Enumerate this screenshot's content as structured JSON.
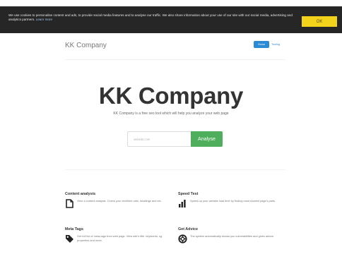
{
  "cookie": {
    "text": "We use cookies to personalise content and ads, to provide social media features and to analyse our traffic. We also share information about your use of our site with our social media, advertising and analytics partners.",
    "link": "Learn more",
    "ok_label": "OK"
  },
  "header": {
    "brand": "KK Company",
    "nav": {
      "home": "Home",
      "tools": "Tooling"
    }
  },
  "hero": {
    "title": "KK Company",
    "subtitle": "KK Company is a free seo tool which will help you analyze your web page",
    "input_placeholder": "website.com",
    "analyse_label": "Analyse"
  },
  "features": [
    {
      "title": "Content analysis",
      "desc": "View a content analysis. Check your text/html ratio, headings and etc.",
      "icon": "file-icon"
    },
    {
      "title": "Speed Test",
      "desc": "Speed-up your website load time by finding most slowest page's parts.",
      "icon": "bar-chart-icon"
    },
    {
      "title": "Meta Tags",
      "desc": "Get full list of meta-tags from web page. View site's title, keywords, og properties and more.",
      "icon": "tag-icon"
    },
    {
      "title": "Get Advice",
      "desc": "The system automatically shows you vulnerabilities and gives advice.",
      "icon": "support-icon"
    }
  ]
}
